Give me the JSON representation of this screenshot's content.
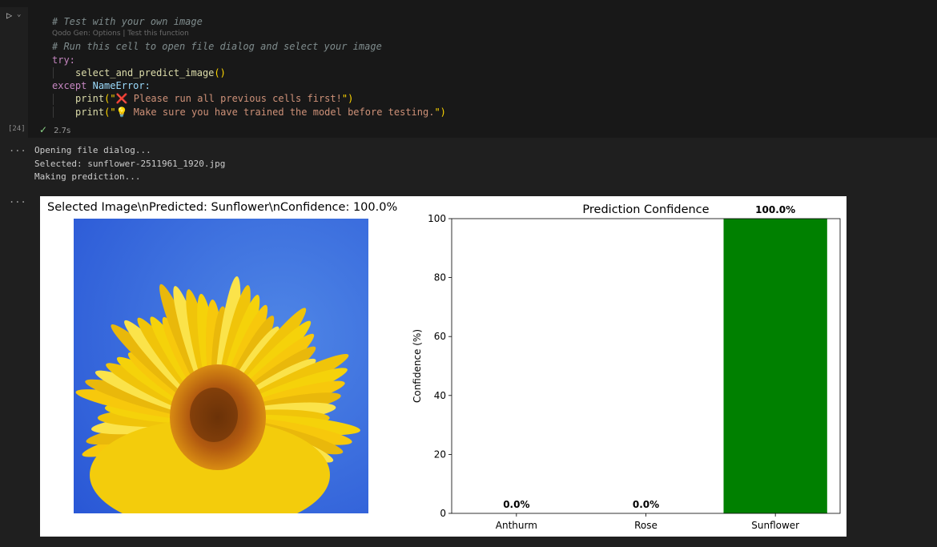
{
  "editor": {
    "code_lines": [
      {
        "type": "comment",
        "text": "# Test with your own image"
      },
      {
        "type": "codelens",
        "text": "Qodo Gen: Options | Test this function"
      },
      {
        "type": "comment",
        "text": "# Run this cell to open file dialog and select your image"
      },
      {
        "type": "kw",
        "text": "try:"
      },
      {
        "type": "call",
        "indent": 1,
        "fn": "select_and_predict_image",
        "args": "()"
      },
      {
        "type": "except",
        "kw": "except",
        "name": "NameError:"
      },
      {
        "type": "print",
        "indent": 1,
        "fn": "print",
        "open": "(\"",
        "emoji": "❌",
        "text": " Please run all previous cells first!",
        "close": "\")"
      },
      {
        "type": "print",
        "indent": 1,
        "fn": "print",
        "open": "(\"",
        "emoji": "💡",
        "text": " Make sure you have trained the model before testing.",
        "close": "\")"
      }
    ],
    "exec_count": "[24]",
    "exec_time": "2.7s",
    "output_dots": "...",
    "output_lines": [
      "Opening file dialog...",
      "Selected: sunflower-2511961_1920.jpg",
      "Making prediction..."
    ]
  },
  "figure": {
    "image_title": "Selected Image\\nPredicted: Sunflower\\nConfidence: 100.0%"
  },
  "chart_data": {
    "type": "bar",
    "title": "Prediction Confidence",
    "xlabel": "",
    "ylabel": "Confidence (%)",
    "categories": [
      "Anthurm",
      "Rose",
      "Sunflower"
    ],
    "values": [
      0.0,
      0.0,
      100.0
    ],
    "value_labels": [
      "0.0%",
      "0.0%",
      "100.0%"
    ],
    "colors": [
      "#808080",
      "#808080",
      "#008000"
    ],
    "yticks": [
      0,
      20,
      40,
      60,
      80,
      100
    ],
    "ylim": [
      0,
      100
    ],
    "grid": false
  }
}
